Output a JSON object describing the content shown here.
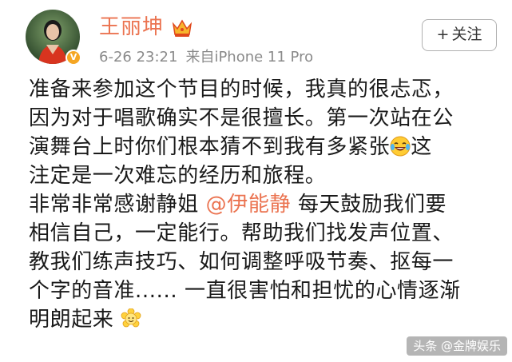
{
  "colors": {
    "accent": "#eb7350",
    "text": "#1a1a1a",
    "meta": "#8a8a8a",
    "badge": "#f5a623"
  },
  "header": {
    "avatar_icon": "avatar-photo",
    "vip_badge": "V",
    "username": "王丽坤",
    "crown_icon": "crown-icon",
    "time": "6-26 23:21",
    "source": "来自iPhone 11 Pro",
    "follow": {
      "plus": "+",
      "label": "关注"
    }
  },
  "post": {
    "p1": {
      "l1": "准备来参加这个节目的时候，我真的很忐忑，",
      "l2": "因为对于唱歌确实不是很擅长。第一次站在公",
      "l3a": "演舞台上时你们根本猜不到我有多紧张",
      "l3b": "这",
      "l4": "注定是一次难忘的经历和旅程。"
    },
    "p2": {
      "l1a": "非常非常感谢静姐 ",
      "mention": "@伊能静",
      "l1b": " 每天鼓励我们要",
      "l2": "相信自己，一定能行。帮助我们找发声位置、",
      "l3": "教我们练声技巧、如何调整呼吸节奏、抠每一",
      "l4": "个字的音准...... 一直很害怕和担忧的心情逐渐",
      "l5": "明朗起来"
    },
    "emoji_laugh": "laughing-tears-emoji",
    "emoji_flower": "smiling-flower-emoji"
  },
  "watermark": "头条 @金牌娱乐"
}
